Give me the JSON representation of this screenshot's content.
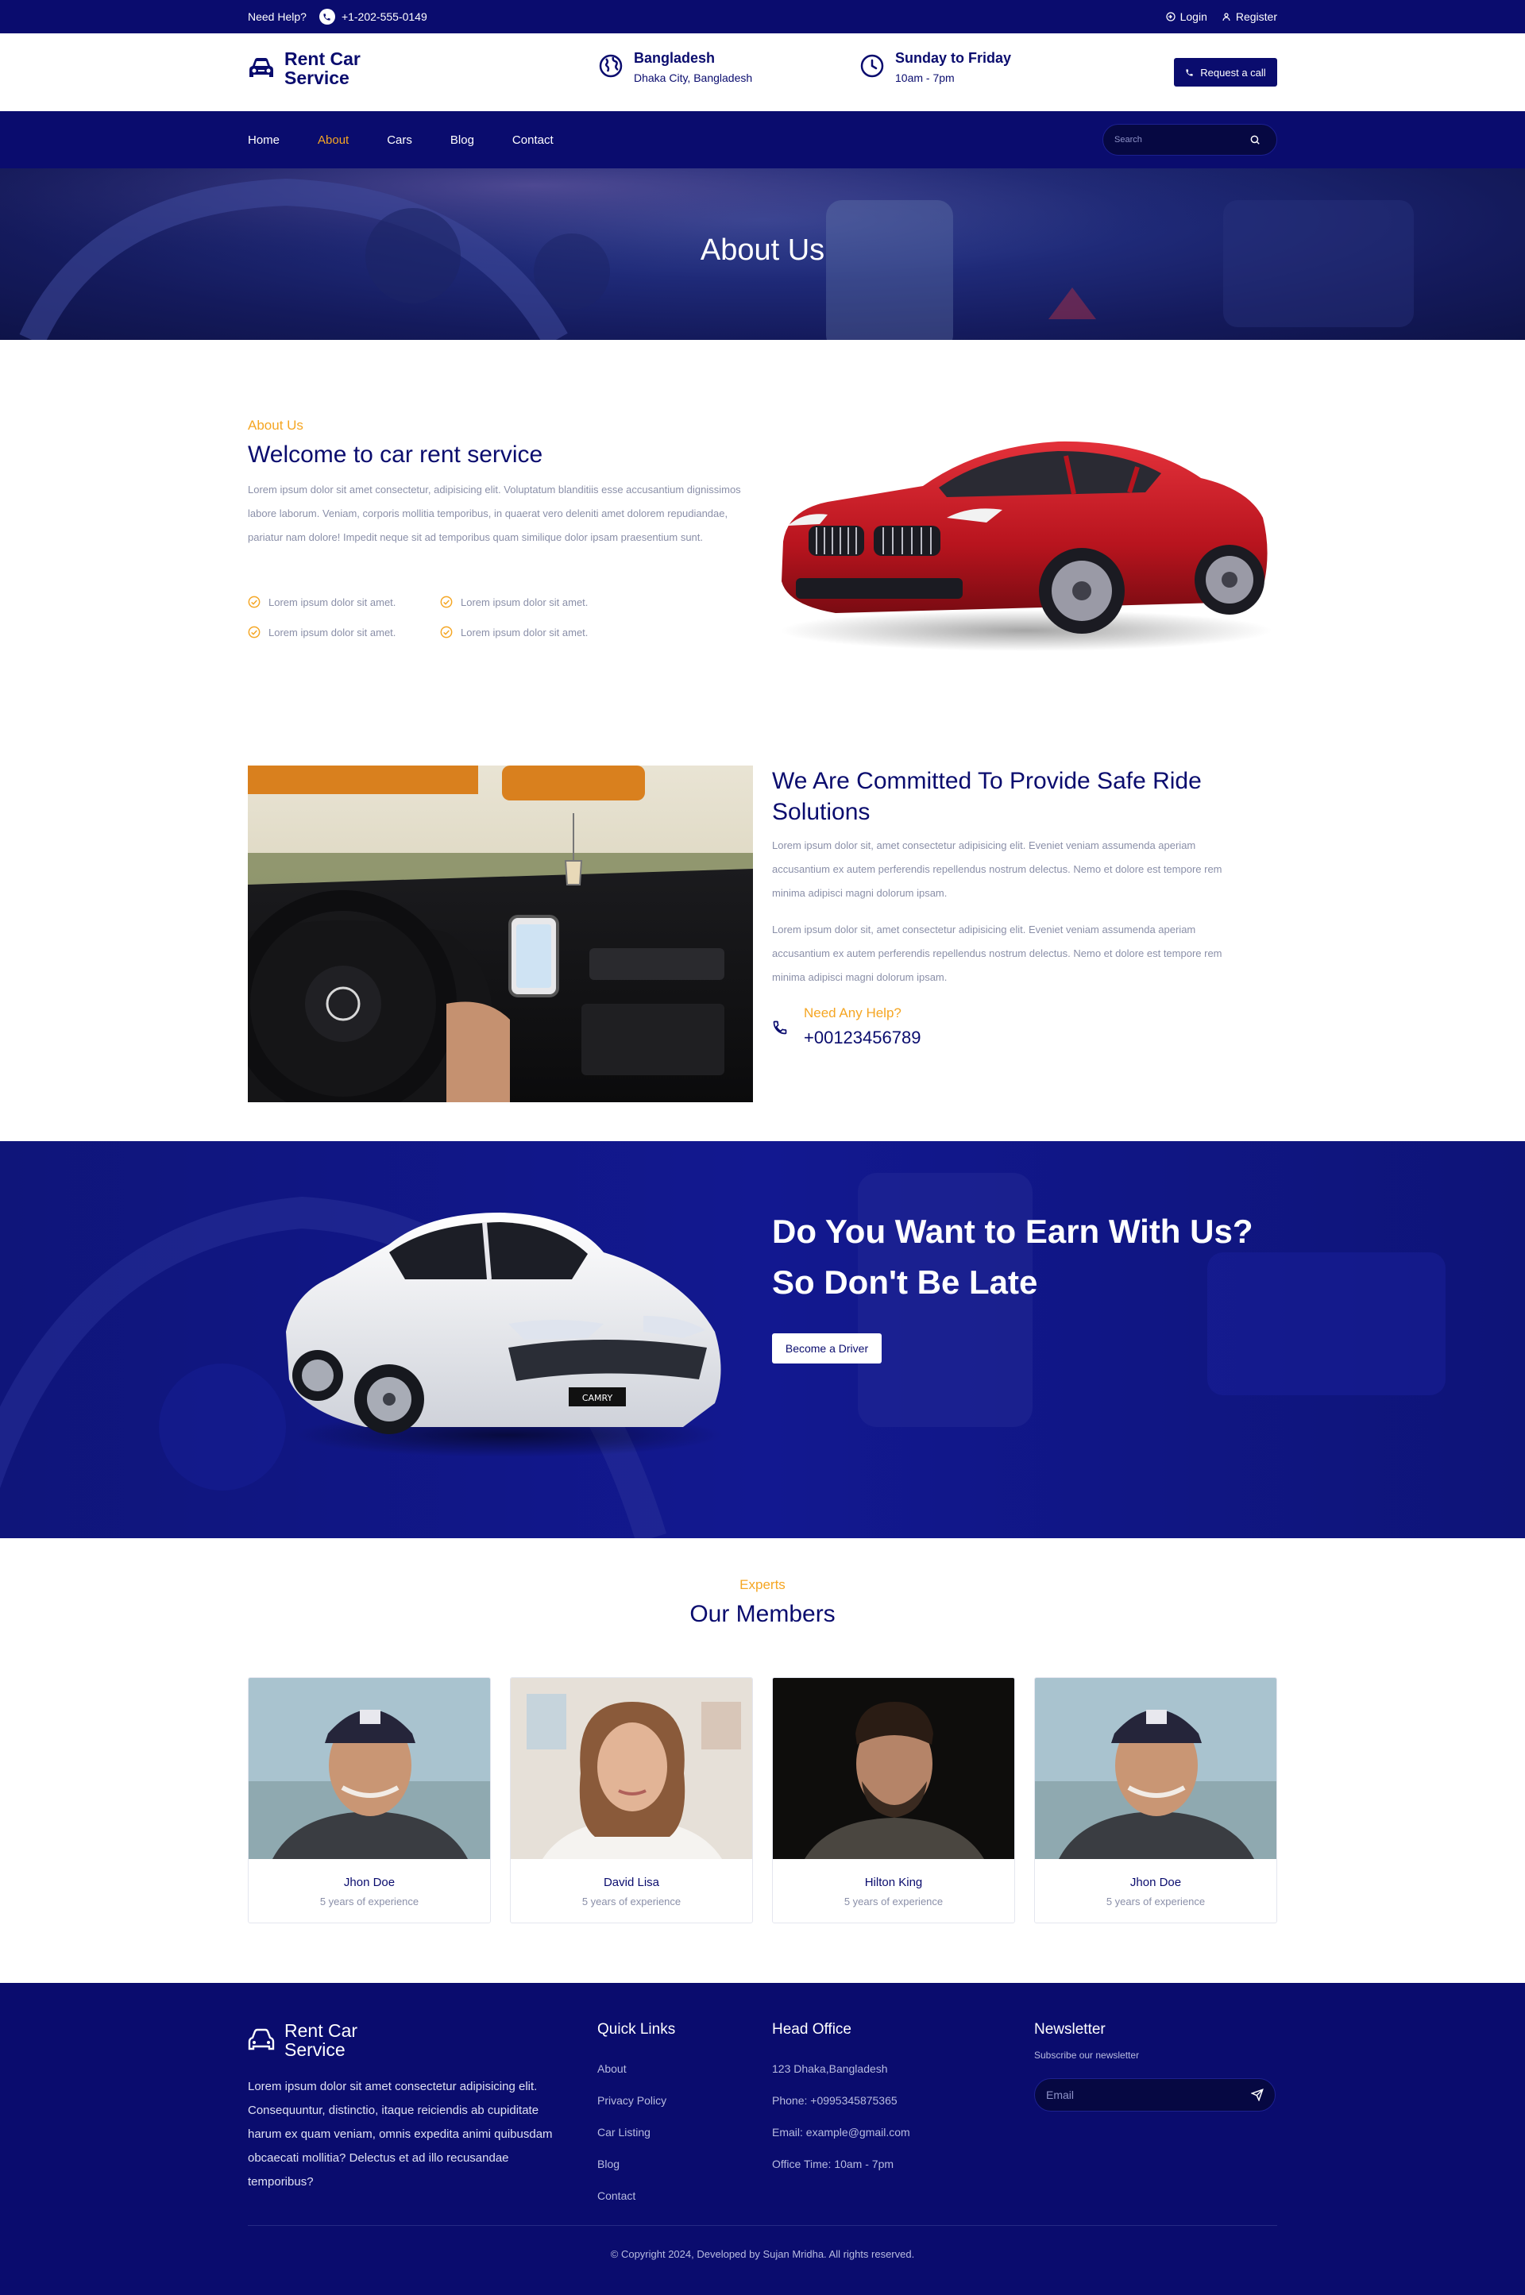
{
  "topbar": {
    "help_label": "Need Help?",
    "phone": "+1-202-555-0149",
    "login": "Login",
    "register": "Register"
  },
  "header": {
    "brand": "Rent Car Service",
    "location_title": "Bangladesh",
    "location_sub": "Dhaka City, Bangladesh",
    "hours_title": "Sunday to Friday",
    "hours_sub": "10am - 7pm",
    "request_button": "Request a call"
  },
  "nav": {
    "items": [
      {
        "label": "Home",
        "active": false
      },
      {
        "label": "About",
        "active": true
      },
      {
        "label": "Cars",
        "active": false
      },
      {
        "label": "Blog",
        "active": false
      },
      {
        "label": "Contact",
        "active": false
      }
    ],
    "search_placeholder": "Search"
  },
  "hero": {
    "title": "About Us"
  },
  "about": {
    "kicker": "About Us",
    "title": "Welcome to car rent service",
    "paragraph": "Lorem ipsum dolor sit amet consectetur, adipisicing elit. Voluptatum blanditiis esse accusantium dignissimos labore laborum. Veniam, corporis mollitia temporibus, in quaerat vero deleniti amet dolorem repudiandae, pariatur nam dolore! Impedit neque sit ad temporibus quam similique dolor ipsam praesentium sunt.",
    "checklist": [
      "Lorem ipsum dolor sit amet.",
      "Lorem ipsum dolor sit amet.",
      "Lorem ipsum dolor sit amet.",
      "Lorem ipsum dolor sit amet."
    ]
  },
  "committed": {
    "title": "We Are Committed To Provide Safe Ride Solutions",
    "paragraph1": "Lorem ipsum dolor sit, amet consectetur adipisicing elit. Eveniet veniam assumenda aperiam accusantium ex autem perferendis repellendus nostrum delectus. Nemo et dolore est tempore rem minima adipisci magni dolorum ipsam.",
    "paragraph2": "Lorem ipsum dolor sit, amet consectetur adipisicing elit. Eveniet veniam assumenda aperiam accusantium ex autem perferendis repellendus nostrum delectus. Nemo et dolore est tempore rem minima adipisci magni dolorum ipsam.",
    "help_label": "Need Any Help?",
    "help_phone": "+00123456789"
  },
  "earn": {
    "title": "Do You Want to Earn With Us? So Don't Be Late",
    "button": "Become a Driver",
    "car_plate": "CAMRY"
  },
  "members": {
    "kicker": "Experts",
    "title": "Our Members",
    "list": [
      {
        "name": "Jhon Doe",
        "experience": "5 years of experience"
      },
      {
        "name": "David Lisa",
        "experience": "5 years of experience"
      },
      {
        "name": "Hilton King",
        "experience": "5 years of experience"
      },
      {
        "name": "Jhon Doe",
        "experience": "5 years of experience"
      }
    ]
  },
  "footer": {
    "brand": "Rent Car Service",
    "description": "Lorem ipsum dolor sit amet consectetur adipisicing elit. Consequuntur, distinctio, itaque reiciendis ab cupiditate harum ex quam veniam, omnis expedita animi quibusdam obcaecati mollitia? Delectus et ad illo recusandae temporibus?",
    "quick_links_title": "Quick Links",
    "quick_links": [
      "About",
      "Privacy Policy",
      "Car Listing",
      "Blog",
      "Contact"
    ],
    "head_office_title": "Head Office",
    "head_office": [
      "123 Dhaka,Bangladesh",
      "Phone: +0995345875365",
      "Email: example@gmail.com",
      "Office Time: 10am - 7pm"
    ],
    "newsletter_title": "Newsletter",
    "newsletter_sub": "Subscribe our newsletter",
    "newsletter_placeholder": "Email",
    "copyright": "© Copyright 2024, Developed by Sujan Mridha. All rights reserved."
  },
  "colors": {
    "primary": "#0a0c6e",
    "accent": "#f5a623",
    "muted_text": "#8a8fa8"
  },
  "icons": [
    "phone-icon",
    "login-icon",
    "user-icon",
    "car-icon",
    "globe-icon",
    "clock-icon",
    "search-icon",
    "check-circle-icon",
    "send-icon"
  ]
}
